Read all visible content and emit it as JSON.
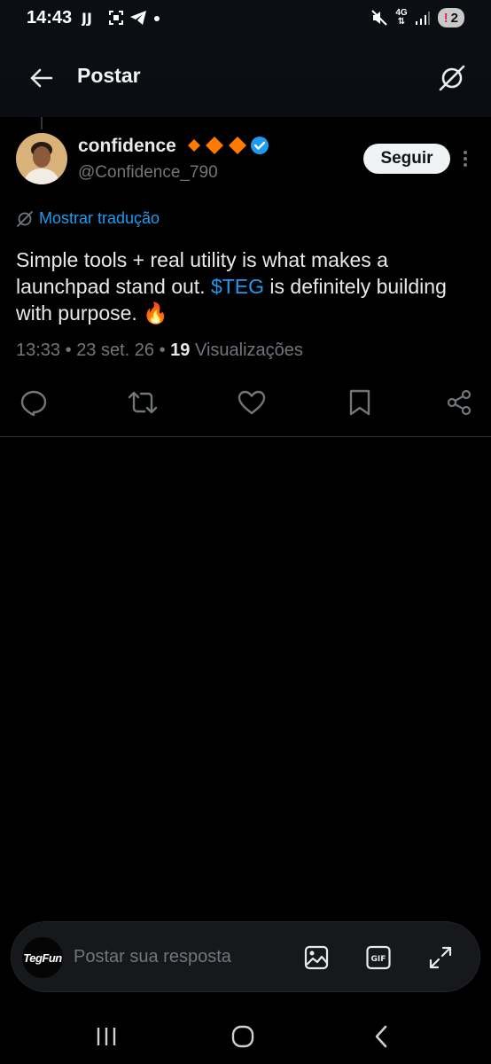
{
  "status_bar": {
    "time": "14:43",
    "network": "4G",
    "notification_count": "2",
    "notification_alert": "!"
  },
  "header": {
    "title": "Postar"
  },
  "post": {
    "author_name": "confidence",
    "author_handle": "@Confidence_790",
    "follow_label": "Seguir",
    "translate_label": "Mostrar tradução",
    "text_before": "Simple tools + real utility is what makes a launchpad stand out. ",
    "cashtag": "$TEG",
    "text_after": " is definitely building with purpose. 🔥",
    "time": "13:33",
    "date": "23 set. 26",
    "views_count": "19",
    "views_label": "Visualizações",
    "sep": " • "
  },
  "reply_bar": {
    "avatar_text": "TegFun",
    "placeholder": "Postar sua resposta"
  },
  "colors": {
    "background": "#000000",
    "accent": "#1d9bf0",
    "muted": "#71767b",
    "verified": "#1d9bf0",
    "diamond": "#ff7a00"
  },
  "icons": {
    "back": "arrow-left-icon",
    "grok": "grok-icon",
    "reply": "reply-icon",
    "repost": "repost-icon",
    "like": "heart-icon",
    "bookmark": "bookmark-icon",
    "share": "share-icon",
    "image": "image-icon",
    "gif": "gif-icon",
    "expand": "expand-icon"
  }
}
